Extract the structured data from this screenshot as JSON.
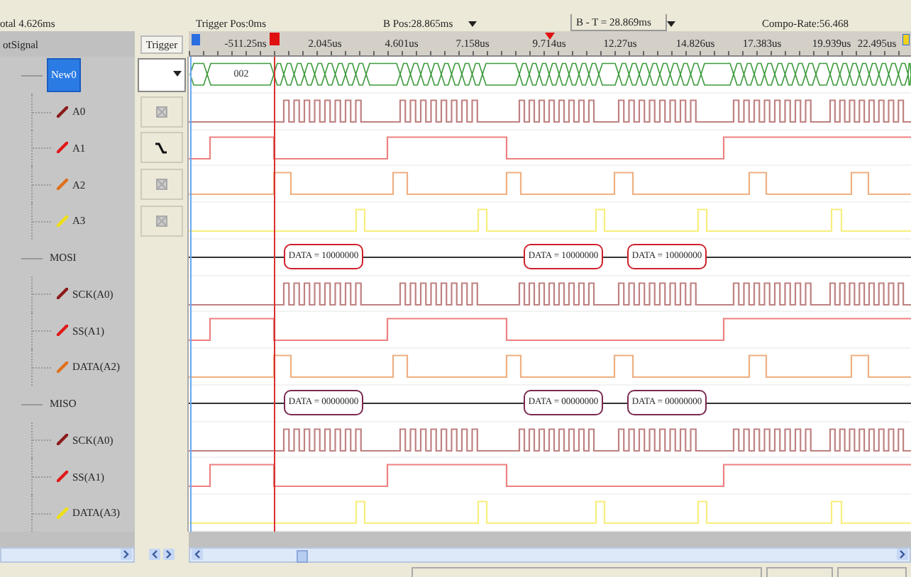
{
  "info": {
    "total": "otal 4.626ms",
    "trigger_pos": "Trigger Pos:0ms",
    "b_pos": "B Pos:28.865ms",
    "b_minus_t": "B - T = 28.869ms",
    "compo_rate": "Compo-Rate:56.468"
  },
  "headers": {
    "signal": "otSignal",
    "trigger": "Trigger"
  },
  "ruler": {
    "ticks": [
      "-511.25ns",
      "2.045us",
      "4.601us",
      "7.158us",
      "9.714us",
      "12.27us",
      "14.826us",
      "17.383us",
      "19.939us",
      "22.495us"
    ]
  },
  "groups": [
    {
      "name": "New0",
      "selected": true,
      "kind": "bus",
      "bus_value": "002",
      "children": [
        {
          "name": "A0",
          "color": "#8b1a1a",
          "kind": "clock",
          "trigger_edge": false
        },
        {
          "name": "A1",
          "color": "#e01818",
          "kind": "select",
          "trigger_edge": true
        },
        {
          "name": "A2",
          "color": "#e0701c",
          "kind": "strobe",
          "trigger_edge": false
        },
        {
          "name": "A3",
          "color": "#f0e010",
          "kind": "sample",
          "trigger_edge": false
        }
      ]
    },
    {
      "name": "MOSI",
      "selected": false,
      "kind": "decoder",
      "color": "#d0202c",
      "packets": [
        "DATA = 10000000",
        "DATA = 10000000",
        "DATA = 10000000"
      ],
      "children": [
        {
          "name": "SCK(A0)",
          "color": "#8b1a1a",
          "kind": "clock"
        },
        {
          "name": "SS(A1)",
          "color": "#e01818",
          "kind": "select"
        },
        {
          "name": "DATA(A2)",
          "color": "#e0701c",
          "kind": "strobe"
        }
      ]
    },
    {
      "name": "MISO",
      "selected": false,
      "kind": "decoder",
      "color": "#7a2a50",
      "packets": [
        "DATA = 00000000",
        "DATA = 00000000",
        "DATA = 00000000"
      ],
      "children": [
        {
          "name": "SCK(A0)",
          "color": "#8b1a1a",
          "kind": "clock"
        },
        {
          "name": "SS(A1)",
          "color": "#e01818",
          "kind": "select"
        },
        {
          "name": "DATA(A3)",
          "color": "#f0e010",
          "kind": "sample"
        }
      ]
    }
  ]
}
